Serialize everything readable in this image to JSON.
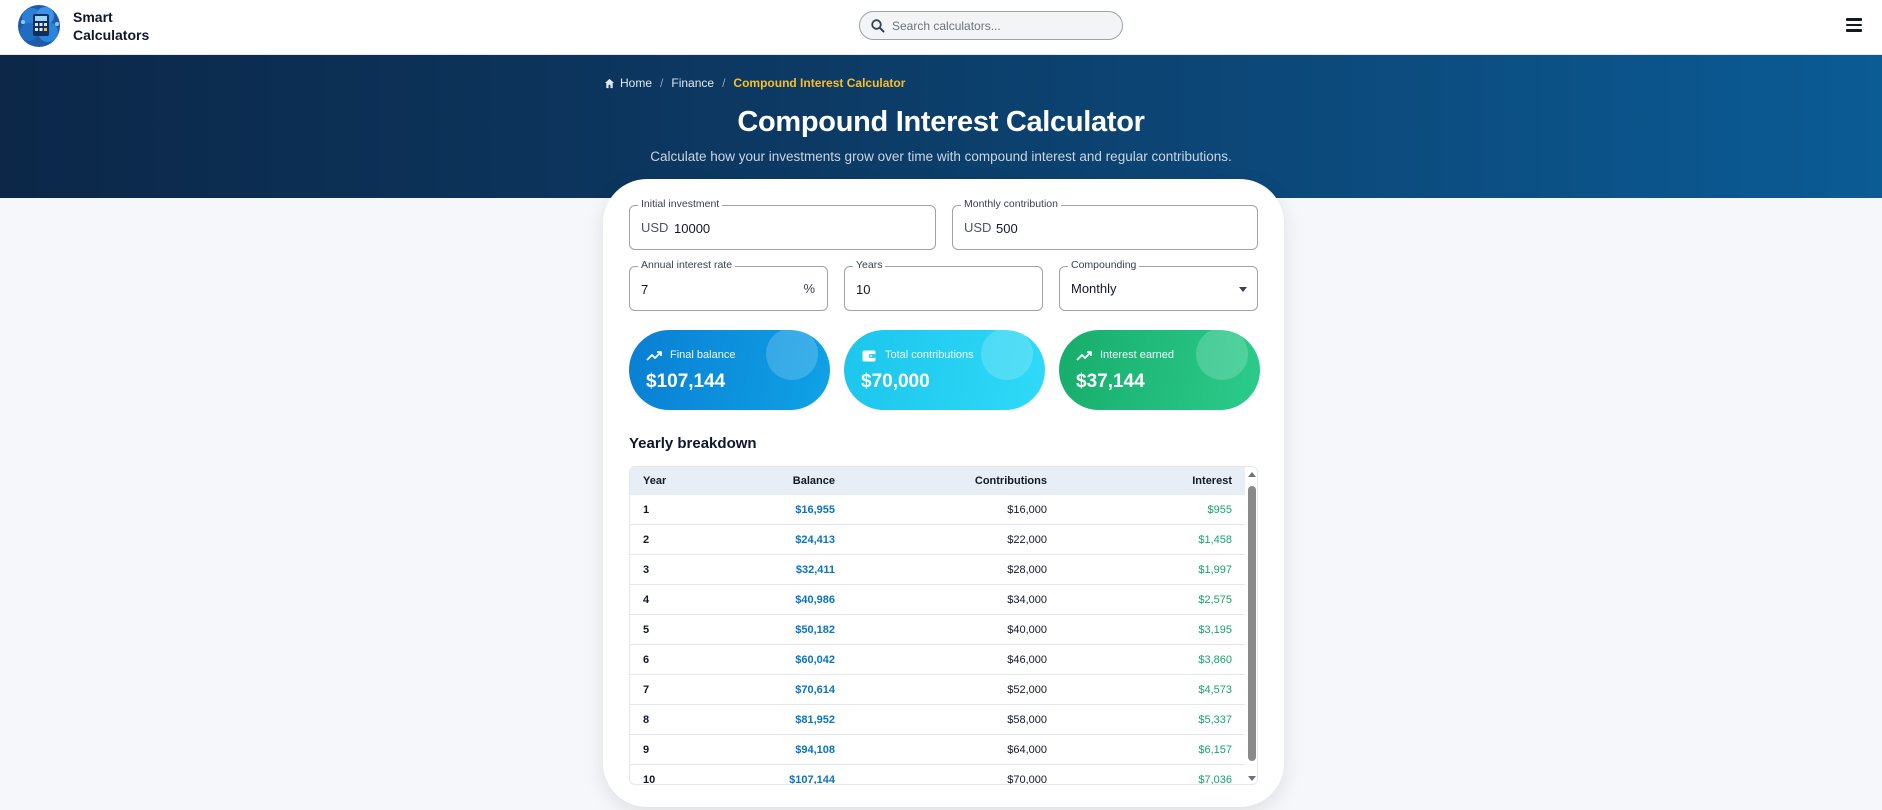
{
  "brand": {
    "line1": "Smart",
    "line2": "Calculators",
    "logo_icon": "brain-calculator-logo"
  },
  "search": {
    "placeholder": "Search calculators...",
    "icon": "search-icon"
  },
  "menu": {
    "icon": "hamburger-menu-icon"
  },
  "breadcrumb": {
    "home": "Home",
    "section": "Finance",
    "current": "Compound Interest Calculator"
  },
  "hero": {
    "title": "Compound Interest Calculator",
    "subtitle": "Calculate how your investments grow over time with compound interest and regular contributions."
  },
  "form": {
    "initial_investment": {
      "label": "Initial investment",
      "prefix": "USD",
      "value": "10000"
    },
    "monthly_contribution": {
      "label": "Monthly contribution",
      "prefix": "USD",
      "value": "500"
    },
    "annual_rate": {
      "label": "Annual interest rate",
      "value": "7",
      "suffix": "%"
    },
    "years": {
      "label": "Years",
      "value": "10"
    },
    "compounding": {
      "label": "Compounding",
      "value": "Monthly"
    }
  },
  "stats": {
    "final_balance": {
      "label": "Final balance",
      "value": "$107,144",
      "icon": "trending-up-icon",
      "color": "#0b8fd8"
    },
    "total_contributions": {
      "label": "Total contributions",
      "value": "$70,000",
      "icon": "wallet-icon",
      "color": "#22d3ee"
    },
    "interest_earned": {
      "label": "Interest earned",
      "value": "$37,144",
      "icon": "trending-up-icon",
      "color": "#22c07e"
    }
  },
  "breakdown": {
    "title": "Yearly breakdown",
    "columns": {
      "year": "Year",
      "balance": "Balance",
      "contributions": "Contributions",
      "interest": "Interest"
    },
    "rows": [
      {
        "year": "1",
        "balance": "$16,955",
        "contributions": "$16,000",
        "interest": "$955"
      },
      {
        "year": "2",
        "balance": "$24,413",
        "contributions": "$22,000",
        "interest": "$1,458"
      },
      {
        "year": "3",
        "balance": "$32,411",
        "contributions": "$28,000",
        "interest": "$1,997"
      },
      {
        "year": "4",
        "balance": "$40,986",
        "contributions": "$34,000",
        "interest": "$2,575"
      },
      {
        "year": "5",
        "balance": "$50,182",
        "contributions": "$40,000",
        "interest": "$3,195"
      },
      {
        "year": "6",
        "balance": "$60,042",
        "contributions": "$46,000",
        "interest": "$3,860"
      },
      {
        "year": "7",
        "balance": "$70,614",
        "contributions": "$52,000",
        "interest": "$4,573"
      },
      {
        "year": "8",
        "balance": "$81,952",
        "contributions": "$58,000",
        "interest": "$5,337"
      },
      {
        "year": "9",
        "balance": "$94,108",
        "contributions": "$64,000",
        "interest": "$6,157"
      },
      {
        "year": "10",
        "balance": "$107,144",
        "contributions": "$70,000",
        "interest": "$7,036"
      }
    ]
  }
}
